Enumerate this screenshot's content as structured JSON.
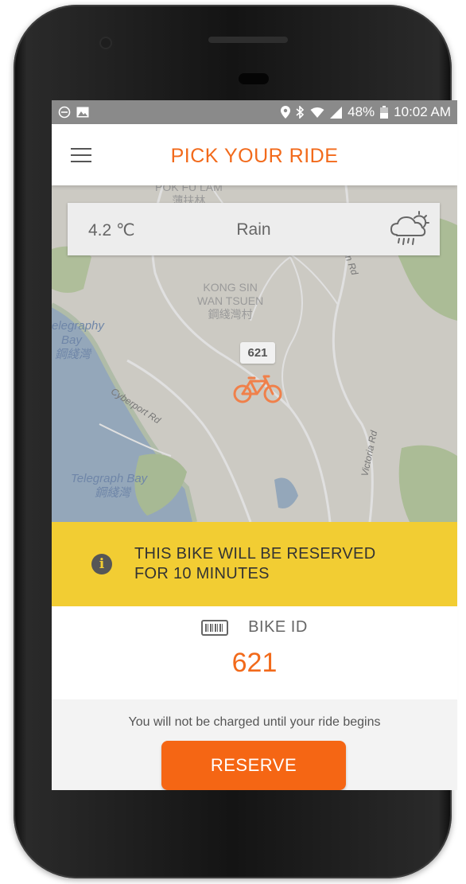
{
  "status_bar": {
    "battery": "48%",
    "time": "10:02 AM"
  },
  "app_bar": {
    "title": "PICK YOUR RIDE"
  },
  "weather": {
    "temperature": "4.2 ℃",
    "condition": "Rain",
    "icon": "cloud-rain-sun-icon"
  },
  "map": {
    "labels": {
      "pok_fu_lam": "POK FU LAM",
      "pok_fu_lam_zh": "薄扶林",
      "kong_sin_1": "KONG SIN",
      "kong_sin_2": "WAN TSUEN",
      "kong_sin_zh": "鋼綫灣村",
      "telegraph_bay_1": "elegraphy",
      "telegraph_bay_2": "Bay",
      "telegraph_bay_zh": "鋼綫灣",
      "telegraph_bay_lower": "Telegraph Bay",
      "telegraph_bay_lower_zh": "鋼綫灣",
      "cyberport_rd": "Cyberport Rd",
      "victoria_rd": "Victoria Rd",
      "road_top_right": "on Rd"
    },
    "marker": {
      "bike_id": "621",
      "icon": "bicycle-icon"
    }
  },
  "banner": {
    "line1": "THIS BIKE WILL BE RESERVED",
    "line2": "FOR 10 MINUTES",
    "icon": "info-icon"
  },
  "bike": {
    "label": "BIKE ID",
    "id": "621",
    "icon": "barcode-icon"
  },
  "footer": {
    "charge_note": "You will not be charged until your ride begins",
    "reserve_label": "RESERVE"
  },
  "colors": {
    "accent": "#f26a1b",
    "button": "#f56614",
    "banner": "#f2cd33",
    "status_bar": "#8a8a8a"
  }
}
